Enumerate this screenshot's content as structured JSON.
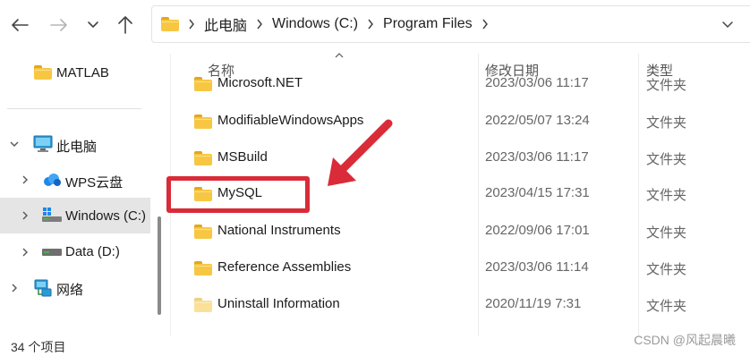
{
  "nav": {
    "back": "back-arrow",
    "forward": "forward-arrow",
    "recent": "chevron-down",
    "up": "up-arrow"
  },
  "address": {
    "segments": [
      "此电脑",
      "Windows (C:)",
      "Program Files"
    ]
  },
  "sidebar": {
    "items": [
      {
        "label": "MATLAB",
        "icon": "folder-icon"
      },
      {
        "label": "此电脑",
        "icon": "computer-icon",
        "expanded": true
      },
      {
        "label": "WPS云盘",
        "icon": "cloud-icon"
      },
      {
        "label": "Windows (C:)",
        "icon": "drive-c-icon",
        "selected": true
      },
      {
        "label": "Data (D:)",
        "icon": "drive-d-icon"
      },
      {
        "label": "网络",
        "icon": "network-icon"
      }
    ]
  },
  "columns": {
    "name": "名称",
    "modified": "修改日期",
    "type": "类型"
  },
  "files": [
    {
      "name": "Microsoft.NET",
      "modified": "2023/03/06 11:17",
      "type": "文件夹"
    },
    {
      "name": "ModifiableWindowsApps",
      "modified": "2022/05/07 13:24",
      "type": "文件夹"
    },
    {
      "name": "MSBuild",
      "modified": "2023/03/06 11:17",
      "type": "文件夹"
    },
    {
      "name": "MySQL",
      "modified": "2023/04/15 17:31",
      "type": "文件夹"
    },
    {
      "name": "National Instruments",
      "modified": "2022/09/06 17:01",
      "type": "文件夹"
    },
    {
      "name": "Reference Assemblies",
      "modified": "2023/03/06 11:14",
      "type": "文件夹"
    },
    {
      "name": "Uninstall Information",
      "modified": "2020/11/19 7:31",
      "type": "文件夹"
    }
  ],
  "status": {
    "item_count": "34 个项目"
  },
  "watermark": "CSDN @风起晨曦",
  "colors": {
    "folder": "#f7c744",
    "annotation": "#d92b38",
    "selection": "#e5e5e5"
  }
}
